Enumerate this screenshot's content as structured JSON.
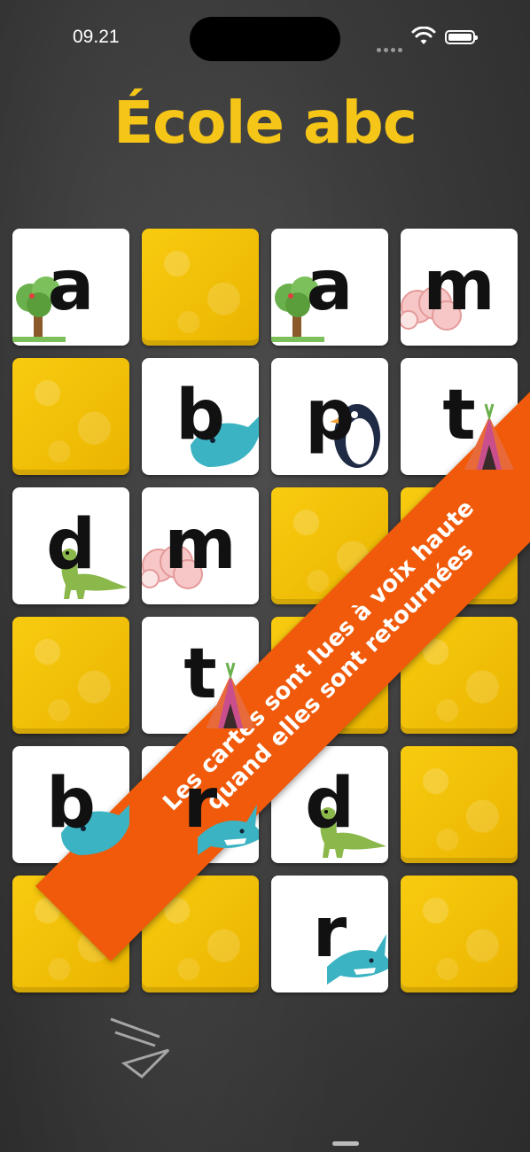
{
  "status": {
    "time": "09.21"
  },
  "app": {
    "title": "École abc"
  },
  "cards": [
    {
      "state": "face",
      "letter": "a",
      "picture": "tree"
    },
    {
      "state": "back",
      "letter": "",
      "picture": ""
    },
    {
      "state": "face",
      "letter": "a",
      "picture": "tree"
    },
    {
      "state": "face",
      "letter": "m",
      "picture": "sheep"
    },
    {
      "state": "back",
      "letter": "",
      "picture": ""
    },
    {
      "state": "face",
      "letter": "b",
      "picture": "whale"
    },
    {
      "state": "face",
      "letter": "p",
      "picture": "penguin"
    },
    {
      "state": "face",
      "letter": "t",
      "picture": "tipi"
    },
    {
      "state": "face",
      "letter": "d",
      "picture": "dinosaur"
    },
    {
      "state": "face",
      "letter": "m",
      "picture": "sheep"
    },
    {
      "state": "back",
      "letter": "",
      "picture": ""
    },
    {
      "state": "back",
      "letter": "",
      "picture": ""
    },
    {
      "state": "back",
      "letter": "",
      "picture": ""
    },
    {
      "state": "face",
      "letter": "t",
      "picture": "tipi"
    },
    {
      "state": "back",
      "letter": "",
      "picture": ""
    },
    {
      "state": "back",
      "letter": "",
      "picture": ""
    },
    {
      "state": "face",
      "letter": "b",
      "picture": "whale"
    },
    {
      "state": "face",
      "letter": "r",
      "picture": "shark"
    },
    {
      "state": "face",
      "letter": "d",
      "picture": "dinosaur"
    },
    {
      "state": "back",
      "letter": "",
      "picture": ""
    },
    {
      "state": "back",
      "letter": "",
      "picture": ""
    },
    {
      "state": "back",
      "letter": "",
      "picture": ""
    },
    {
      "state": "face",
      "letter": "r",
      "picture": "shark"
    },
    {
      "state": "back",
      "letter": "",
      "picture": ""
    }
  ],
  "banner": {
    "line1": "Les cartes sont lues à voix haute",
    "line2": "quand elles sont retournées"
  },
  "colors": {
    "accent": "#f5c518",
    "banner": "#f05a0a",
    "card_back": "#f8cb10"
  }
}
